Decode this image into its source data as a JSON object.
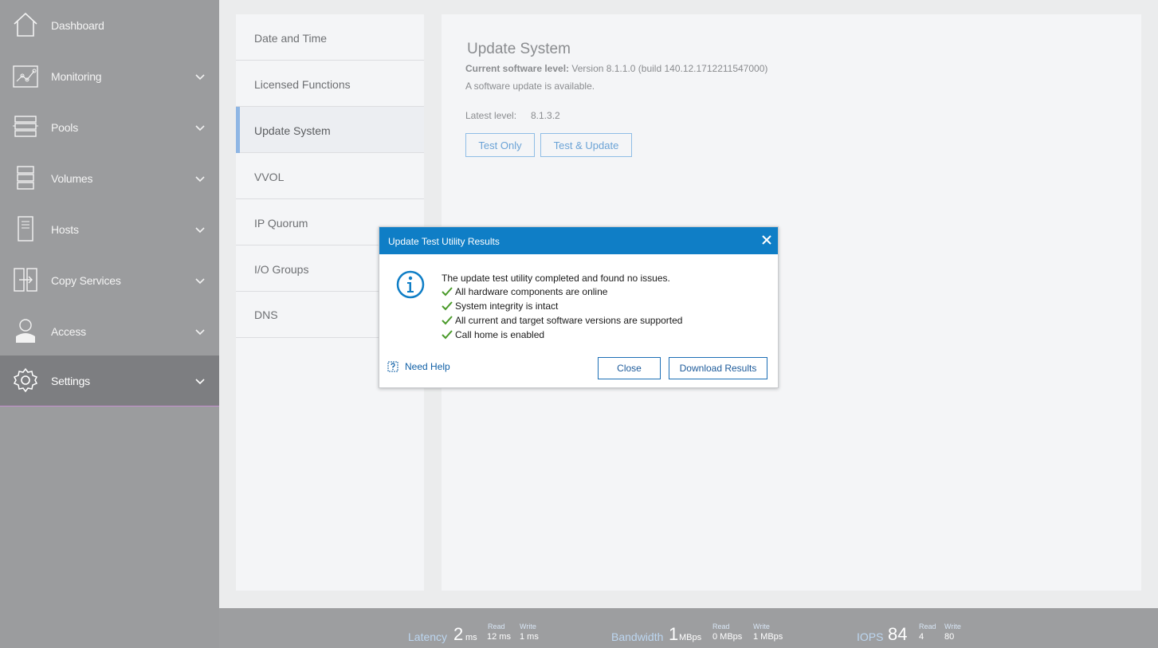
{
  "sidebar": {
    "items": [
      {
        "label": "Dashboard",
        "icon": "home-icon"
      },
      {
        "label": "Monitoring",
        "icon": "monitoring-icon"
      },
      {
        "label": "Pools",
        "icon": "pools-icon"
      },
      {
        "label": "Volumes",
        "icon": "volumes-icon"
      },
      {
        "label": "Hosts",
        "icon": "hosts-icon"
      },
      {
        "label": "Copy Services",
        "icon": "copy-services-icon"
      },
      {
        "label": "Access",
        "icon": "user-icon"
      },
      {
        "label": "Settings",
        "icon": "gear-icon"
      }
    ],
    "active": "Settings",
    "active_underline_color": "#c68fd0"
  },
  "settings_menu": {
    "items": [
      "Date and Time",
      "Licensed Functions",
      "Update System",
      "VVOL",
      "IP Quorum",
      "I/O Groups",
      "DNS"
    ],
    "active": "Update System"
  },
  "main": {
    "title": "Update System",
    "current_level_label": "Current software level:",
    "current_level_value": "Version 8.1.1.0 (build 140.12.1712211547000)",
    "availability": "A software update is available.",
    "latest_label": "Latest level:",
    "latest_value": "8.1.3.2",
    "test_only_label": "Test Only",
    "test_update_label": "Test & Update"
  },
  "dialog": {
    "title": "Update Test Utility Results",
    "message": "The update test utility completed and found no issues.",
    "checks": [
      "All hardware components are online",
      "System integrity is intact",
      "All current and target software versions are supported",
      "Call home is enabled"
    ],
    "help_label": "Need Help",
    "close_label": "Close",
    "download_label": "Download Results",
    "header_color": "#0f7ec6",
    "check_color": "#4a9a2a"
  },
  "statusbar": {
    "latency": {
      "label": "Latency",
      "value": "2",
      "unit": "ms",
      "read_label": "Read",
      "read_value": "12 ms",
      "write_label": "Write",
      "write_value": "1 ms"
    },
    "bandwidth": {
      "label": "Bandwidth",
      "value": "1",
      "unit": "MBps",
      "read_label": "Read",
      "read_value": "0 MBps",
      "write_label": "Write",
      "write_value": "1 MBps"
    },
    "iops": {
      "label": "IOPS",
      "value": "84",
      "read_label": "Read",
      "read_value": "4",
      "write_label": "Write",
      "write_value": "80"
    }
  }
}
